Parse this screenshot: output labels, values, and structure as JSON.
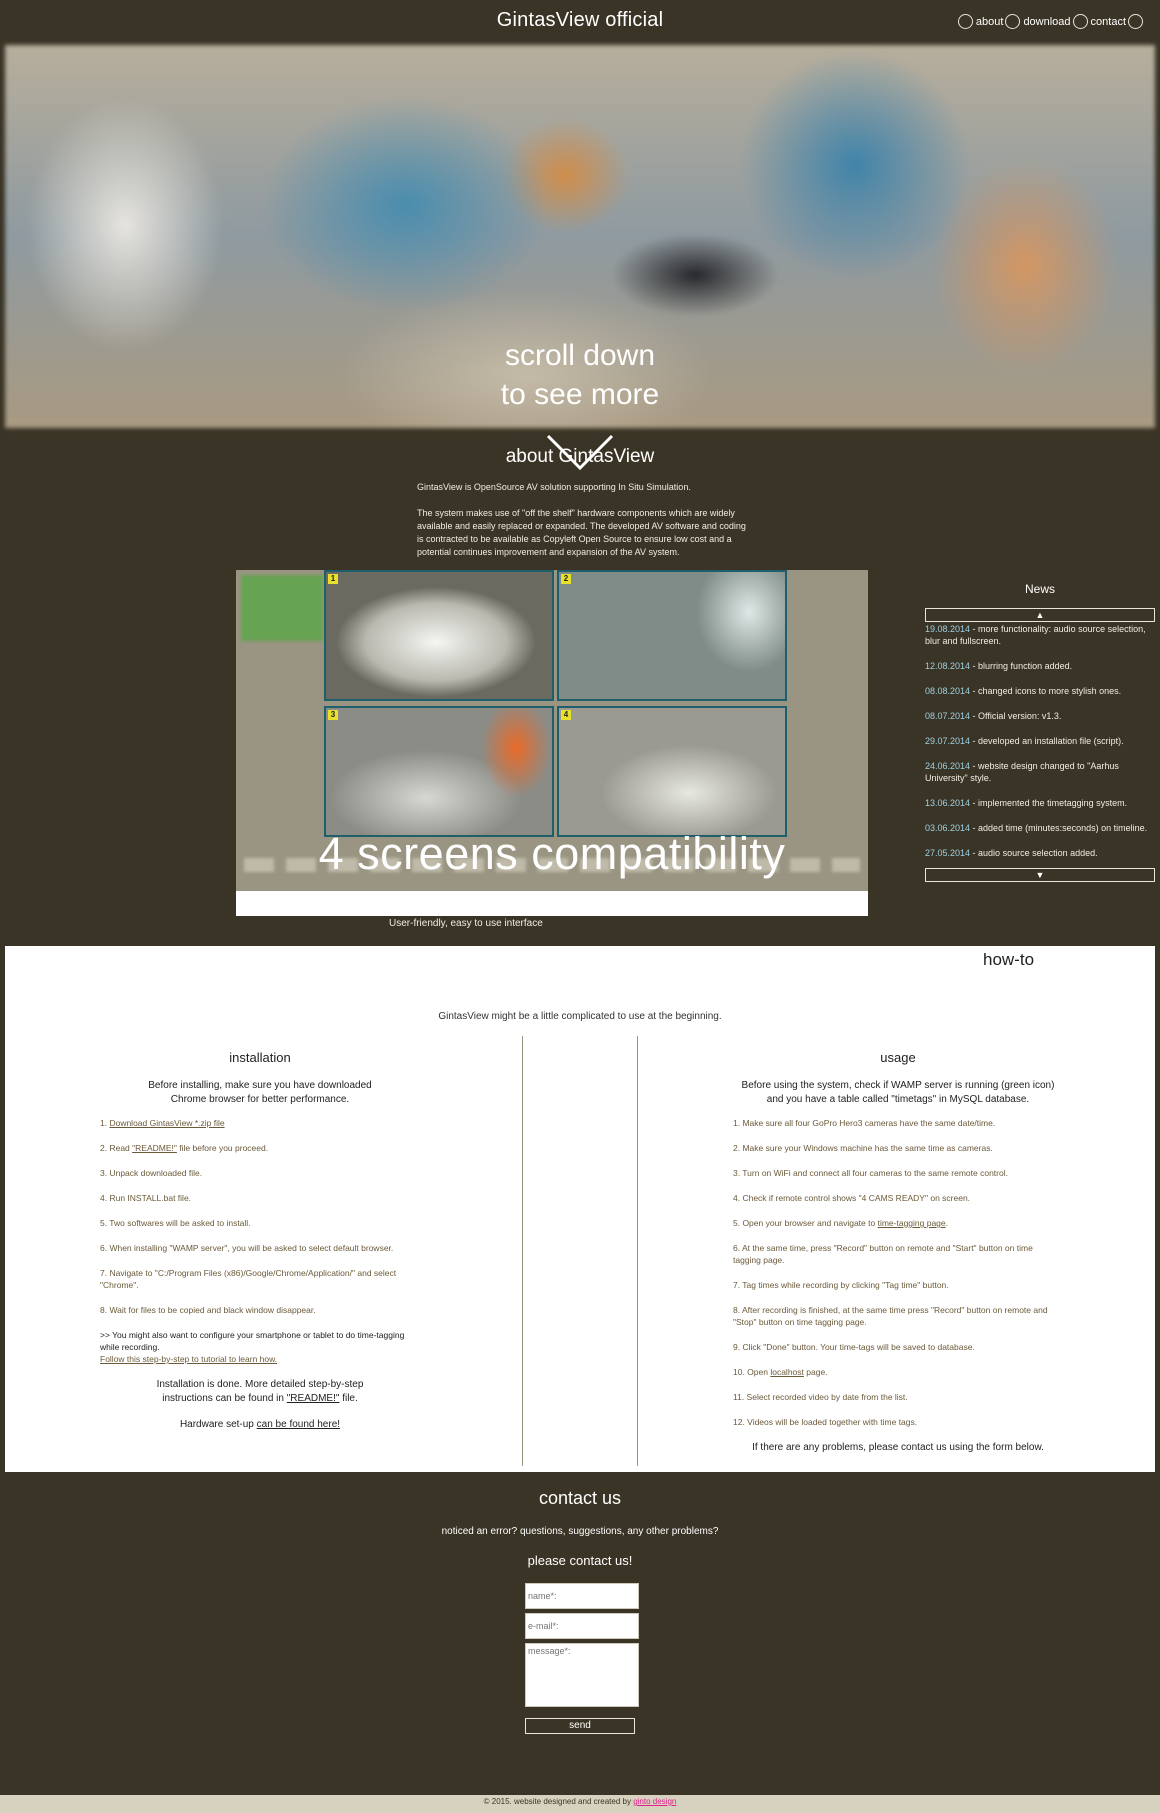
{
  "header": {
    "title": "GintasView official",
    "nav": [
      "about",
      "download",
      "contact"
    ]
  },
  "hero": {
    "line1": "scroll down",
    "line2": "to see more"
  },
  "about": {
    "title": "about GintasView",
    "p1": "GintasView is OpenSource AV solution supporting In Situ Simulation.",
    "p2": "The system makes use of \"off the shelf\" hardware components which are widely available and easily replaced or expanded. The developed AV software and coding is contracted to be available as Copyleft Open Source to ensure low cost and a potential continues improvement and expansion of the AV system.",
    "showcase_caption": "4 screens compatibility",
    "showcase_sub": "User-friendly, easy to use interface",
    "cam_numbers": [
      "1",
      "2",
      "3",
      "4"
    ]
  },
  "news": {
    "title": "News",
    "items": [
      {
        "date": "19.08.2014",
        "text": " - more functionality: audio source selection, blur and fullscreen."
      },
      {
        "date": "12.08.2014",
        "text": " - blurring function added."
      },
      {
        "date": "08.08.2014",
        "text": " - changed icons to more stylish ones."
      },
      {
        "date": "08.07.2014",
        "text": " - Official version: v1.3."
      },
      {
        "date": "29.07.2014",
        "text": " - developed an installation file (script)."
      },
      {
        "date": "24.06.2014",
        "text": " - website design changed to \"Aarhus University\" style."
      },
      {
        "date": "13.06.2014",
        "text": " - implemented the timetagging system."
      },
      {
        "date": "03.06.2014",
        "text": " - added time (minutes:seconds) on timeline."
      },
      {
        "date": "27.05.2014",
        "text": " - audio source selection added."
      }
    ]
  },
  "howto": {
    "title": "how-to",
    "intro": "GintasView might be a little complicated to use at the beginning.",
    "installation": {
      "title": "installation",
      "lead1": "Before installing, make sure you have downloaded",
      "lead2": "Chrome browser for better performance.",
      "s1_pre": "1. ",
      "s1_link": "Download GintasView *.zip file",
      "s2_pre": "2. Read ",
      "s2_link": "\"README!\"",
      "s2_post": " file before you proceed.",
      "s3": "3. Unpack downloaded file.",
      "s4": "4. Run INSTALL.bat file.",
      "s5": "5. Two softwares will be asked to install.",
      "s6": "6. When installing \"WAMP server\", you will be asked to select default browser.",
      "s7": "7. Navigate to \"C:/Program Files (x86)/Google/Chrome/Application/\" and select \"Chrome\".",
      "s8": "8. Wait for files to be copied and black window disappear.",
      "s9": ">> You might also want to configure your smartphone or tablet to do time-tagging while recording.",
      "s9_link": "Follow this step-by-step to tutorial to learn how.",
      "closing1": "Installation is done. More detailed step-by-step",
      "closing2_pre": "instructions can be found in ",
      "closing2_link": "\"README!\"",
      "closing2_post": " file.",
      "hw_pre": "Hardware set-up ",
      "hw_link": "can be found here!"
    },
    "usage": {
      "title": "usage",
      "lead1": "Before using the system, check if WAMP server is running (green icon)",
      "lead2": "and you have a table called \"timetags\" in MySQL database.",
      "s1": "1. Make sure all four GoPro Hero3 cameras have the same date/time.",
      "s2": "2. Make sure your Windows machine has the same time as cameras.",
      "s3": "3. Turn on WiFi and connect all four cameras to the same remote control.",
      "s4": "4. Check if remote control shows \"4 CAMS READY\" on screen.",
      "s5_pre": "5. Open your browser and navigate to ",
      "s5_link": "time-tagging page",
      "s5_post": ".",
      "s6": "6. At the same time, press \"Record\" button on remote and \"Start\" button on time tagging page.",
      "s7": "7. Tag times while recording by clicking \"Tag time\" button.",
      "s8": "8. After recording is finished, at the same time press \"Record\" button on remote and \"Stop\" button on time tagging page.",
      "s9": "9. Click \"Done\" button. Your time-tags will be saved to database.",
      "s10_pre": "10. Open ",
      "s10_link": "localhost",
      "s10_post": " page.",
      "s11": "11. Select recorded video by date from the list.",
      "s12": "12. Videos will be loaded together with time tags.",
      "closing": "If there are any problems, please contact us using the form below."
    }
  },
  "contact": {
    "title": "contact us",
    "sub": "noticed an error? questions, suggestions, any other problems?",
    "cta": "please contact us!",
    "name_placeholder": "name*:",
    "email_placeholder": "e-mail*:",
    "message_placeholder": "message*:",
    "send_label": "send"
  },
  "footer": {
    "text": "© 2015. website designed and created by ",
    "brand": "ginto design",
    "brand_color": "#e0208c"
  },
  "colors": {
    "background": "#3a3426",
    "howto_background": "#ffffff",
    "link_brown": "#6b5a3a",
    "news_date": "#9fd0e0"
  }
}
